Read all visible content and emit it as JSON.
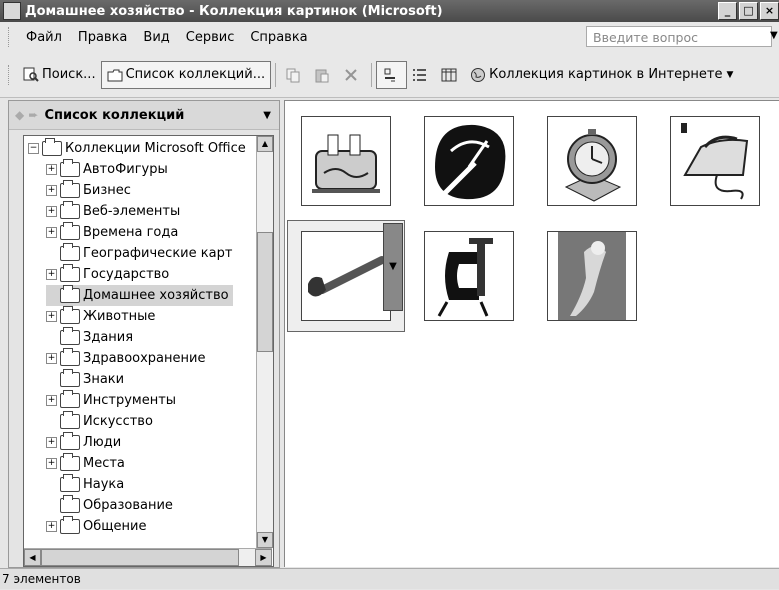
{
  "window": {
    "title": "Домашнее хозяйство - Коллекция картинок (Microsoft)",
    "btn_min": "_",
    "btn_max": "□",
    "btn_close": "×"
  },
  "menu": {
    "items": [
      {
        "label": "Файл"
      },
      {
        "label": "Правка"
      },
      {
        "label": "Вид"
      },
      {
        "label": "Сервис"
      },
      {
        "label": "Справка"
      }
    ],
    "question_placeholder": "Введите вопрос"
  },
  "toolbar": {
    "search_label": "Поиск...",
    "collections_label": "Список коллекций...",
    "online_label": "Коллекция картинок в Интернете"
  },
  "left_pane": {
    "title": "Список коллекций",
    "tree": [
      {
        "label": "Коллекции Microsoft Office",
        "expander": "−",
        "level": 0
      },
      {
        "label": "АвтоФигуры",
        "expander": "+",
        "level": 1
      },
      {
        "label": "Бизнес",
        "expander": "+",
        "level": 1
      },
      {
        "label": "Веб-элементы",
        "expander": "+",
        "level": 1
      },
      {
        "label": "Времена года",
        "expander": "+",
        "level": 1
      },
      {
        "label": "Географические карт",
        "expander": "",
        "level": 1
      },
      {
        "label": "Государство",
        "expander": "+",
        "level": 1
      },
      {
        "label": "Домашнее хозяйство",
        "expander": "",
        "level": 1,
        "selected": true
      },
      {
        "label": "Животные",
        "expander": "+",
        "level": 1
      },
      {
        "label": "Здания",
        "expander": "",
        "level": 1
      },
      {
        "label": "Здравоохранение",
        "expander": "+",
        "level": 1
      },
      {
        "label": "Знаки",
        "expander": "",
        "level": 1
      },
      {
        "label": "Инструменты",
        "expander": "+",
        "level": 1
      },
      {
        "label": "Искусство",
        "expander": "",
        "level": 1
      },
      {
        "label": "Люди",
        "expander": "+",
        "level": 1
      },
      {
        "label": "Места",
        "expander": "+",
        "level": 1
      },
      {
        "label": "Наука",
        "expander": "",
        "level": 1
      },
      {
        "label": "Образование",
        "expander": "",
        "level": 1
      },
      {
        "label": "Общение",
        "expander": "+",
        "level": 1
      }
    ]
  },
  "clips": [
    {
      "icon": "toaster-icon"
    },
    {
      "icon": "meter-icon"
    },
    {
      "icon": "clock-icon"
    },
    {
      "icon": "iron-icon"
    },
    {
      "icon": "wrench-icon",
      "selected": true
    },
    {
      "icon": "clamp-icon"
    },
    {
      "icon": "figure-icon"
    }
  ],
  "status": {
    "text": "7 элементов"
  }
}
